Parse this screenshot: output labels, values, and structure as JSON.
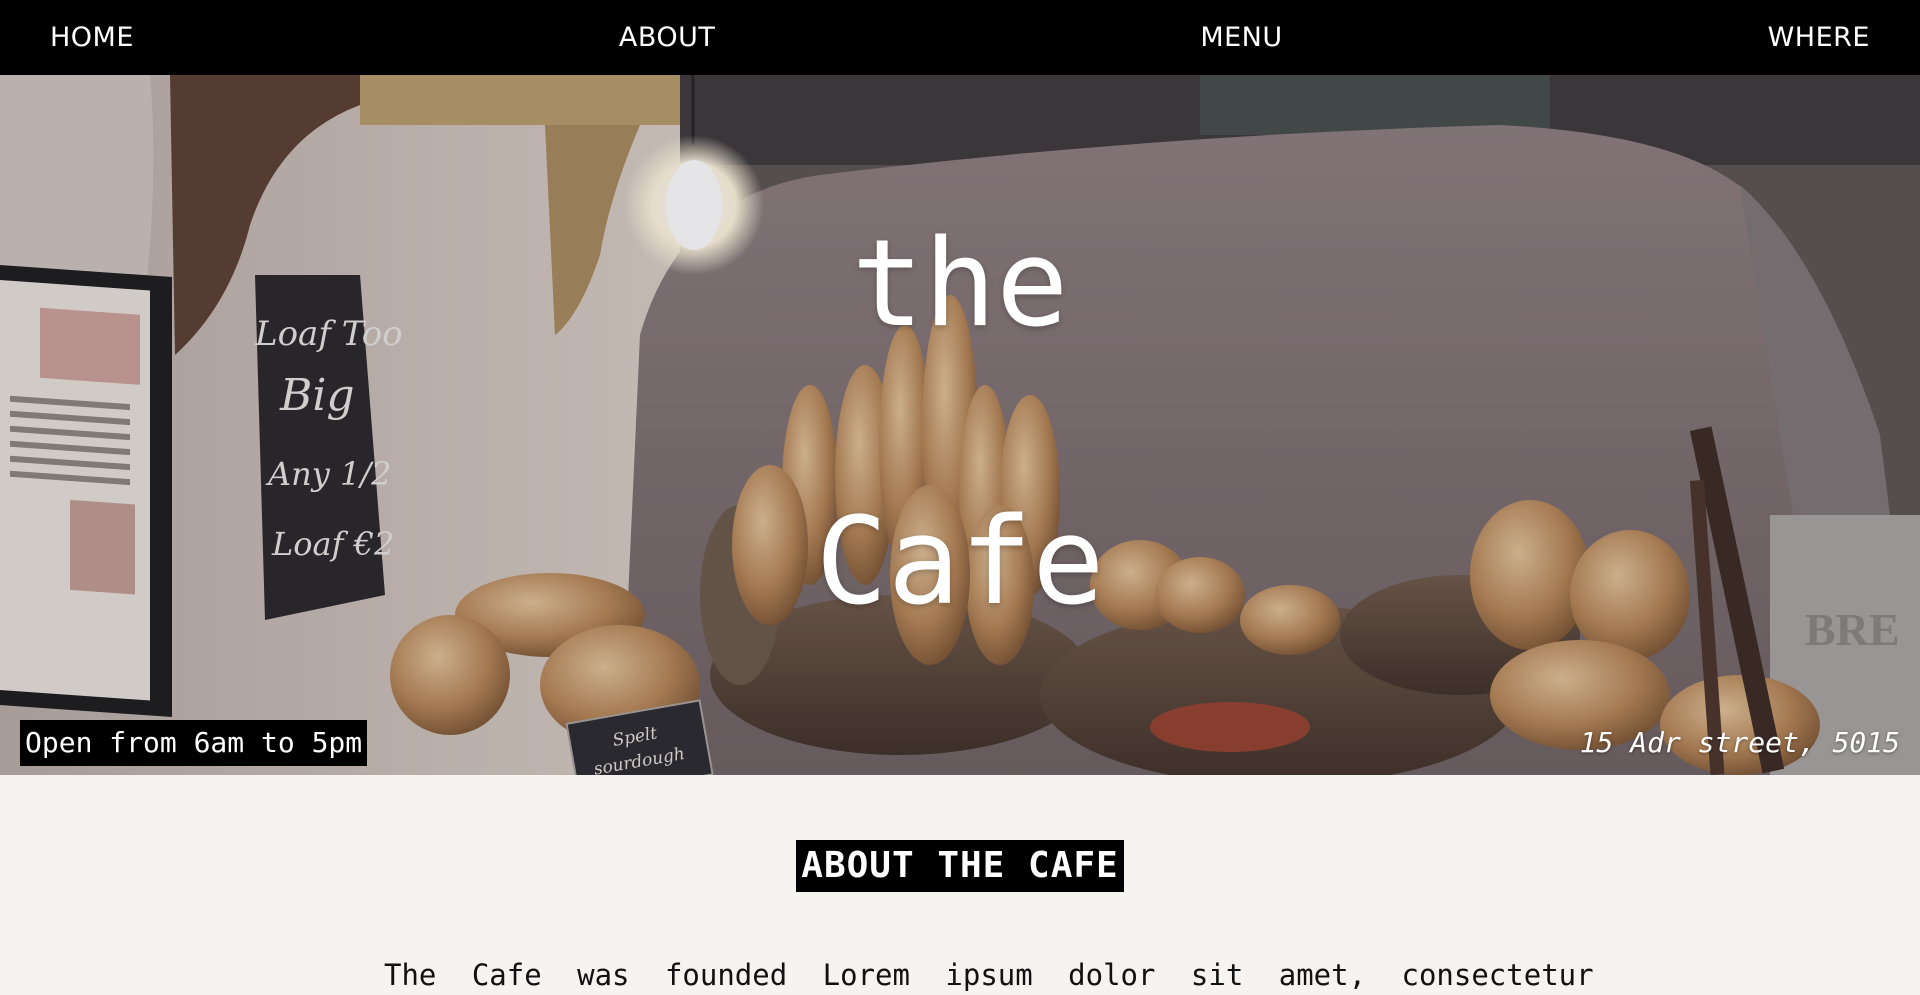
{
  "nav": {
    "home": "HOME",
    "about": "ABOUT",
    "menu": "MENU",
    "where": "WHERE"
  },
  "hero": {
    "title_line1": "the",
    "title_line2": "Cafe",
    "hours": "Open from 6am to 5pm",
    "address": "15 Adr street, 5015",
    "chalkboard": [
      "Loaf Too",
      "Big",
      "Any 1/2",
      "Loaf €2"
    ],
    "sign": [
      "Spelt",
      "sourdough"
    ],
    "bin_text": "BRE"
  },
  "about": {
    "heading": "ABOUT THE CAFE",
    "text": "The Cafe was founded Lorem ipsum dolor sit amet, consectetur"
  },
  "colors": {
    "nav_bg": "#000000",
    "page_bg": "#f5f4f0",
    "hero_text": "#ffffff"
  }
}
